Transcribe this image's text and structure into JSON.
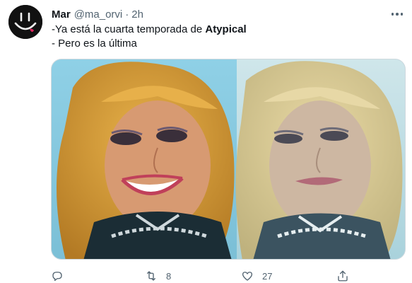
{
  "author": {
    "name": "Mar",
    "handle": "@ma_orvi",
    "separator": "·",
    "time": "2h"
  },
  "tweet": {
    "line1_prefix": "-Ya está la cuarta temporada de ",
    "line1_bold": "Atypical",
    "line2": "- Pero es la última"
  },
  "media": {
    "panels": 2
  },
  "actions": {
    "reply_count": "",
    "retweet_count": "8",
    "like_count": "27"
  },
  "colors": {
    "text": "#0f1419",
    "secondary": "#536471",
    "border": "#cfd9de"
  },
  "icons": [
    "avatar-smiley",
    "more-icon",
    "reply-icon",
    "retweet-icon",
    "like-icon",
    "share-icon"
  ]
}
